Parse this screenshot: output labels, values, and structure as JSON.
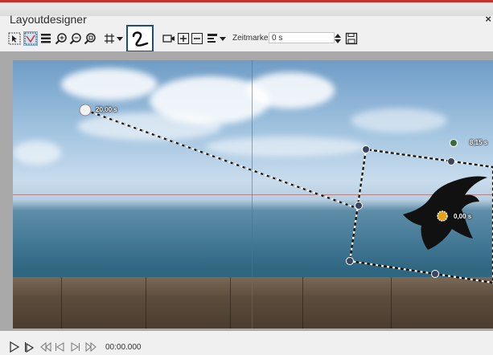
{
  "window": {
    "title": "Layoutdesigner",
    "close_label": "×"
  },
  "toolbar": {
    "icons": [
      "select-icon",
      "path-icon",
      "list-icon",
      "zoom-in-icon",
      "zoom-out-icon",
      "zoom-fit-icon",
      "grid-icon",
      "grid-dropdown-icon",
      "camera-icon",
      "add-icon",
      "remove-icon",
      "align-icon",
      "align-dropdown-icon",
      "spin-icon",
      "save-icon"
    ],
    "zeitmarke_label": "Zeitmarke:",
    "zeitmarke_value": "0 s"
  },
  "canvas": {
    "keyframe_labels": {
      "start": "20,00 s",
      "middle": "8,15 s",
      "current": "0,00 s"
    }
  },
  "playback": {
    "timecode": "00:00.000",
    "icons": [
      "play-icon",
      "play-from-icon",
      "rewind-icon",
      "step-back-icon",
      "step-forward-icon",
      "fast-forward-icon"
    ]
  }
}
